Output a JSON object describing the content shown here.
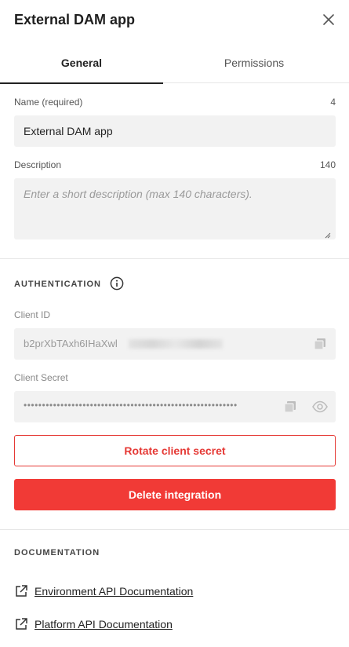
{
  "panel": {
    "title": "External DAM app",
    "close_icon": "close-icon"
  },
  "tabs": [
    {
      "label": "General",
      "active": true
    },
    {
      "label": "Permissions",
      "active": false
    }
  ],
  "general": {
    "name": {
      "label": "Name (required)",
      "counter": "4",
      "value": "External DAM app"
    },
    "description": {
      "label": "Description",
      "counter": "140",
      "placeholder": "Enter a short description (max 140 characters)."
    }
  },
  "authentication": {
    "title": "AUTHENTICATION",
    "info_icon": "info-icon",
    "client_id": {
      "label": "Client ID",
      "value": "b2prXbTAxh6IHaXwl",
      "copy_icon": "copy-icon"
    },
    "client_secret": {
      "label": "Client Secret",
      "masked_value": "••••••••••••••••••••••••••••••••••••••••••••••••••••••••••",
      "copy_icon": "copy-icon",
      "reveal_icon": "eye-icon"
    },
    "rotate_label": "Rotate client secret",
    "delete_label": "Delete integration"
  },
  "documentation": {
    "title": "DOCUMENTATION",
    "links": [
      {
        "label": "Environment API Documentation",
        "icon": "external-link-icon"
      },
      {
        "label": "Platform API Documentation",
        "icon": "external-link-icon"
      }
    ]
  },
  "colors": {
    "danger": "#f13a36",
    "field_bg": "#f2f2f2",
    "text": "#222222",
    "muted": "#555555"
  }
}
